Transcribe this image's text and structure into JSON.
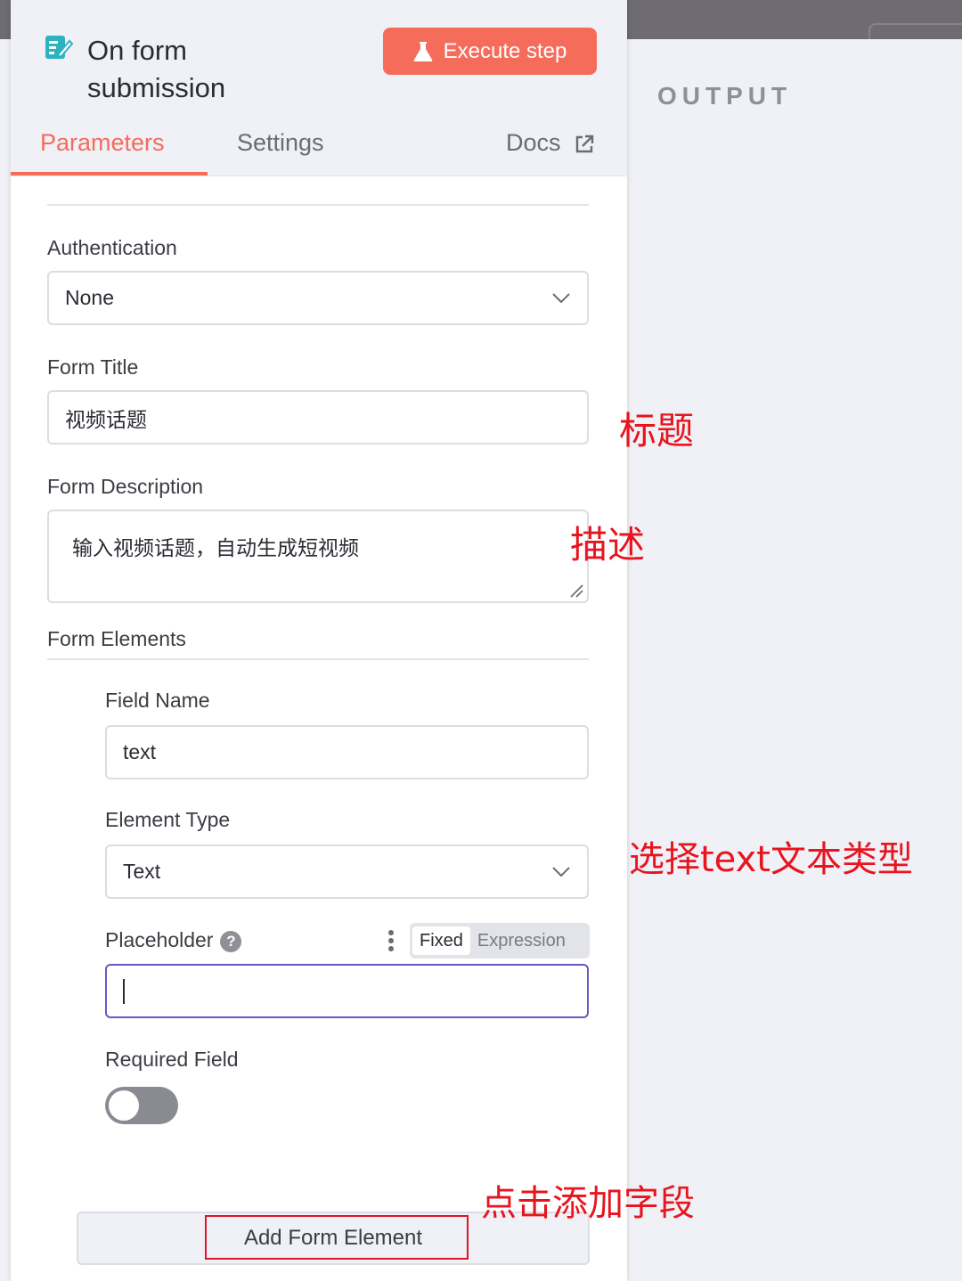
{
  "node": {
    "title_line1": "On form",
    "title_line2": "submission",
    "icon": "form-edit-icon",
    "execute_label": "Execute step",
    "execute_icon": "flask-icon"
  },
  "tabs": {
    "parameters": "Parameters",
    "settings": "Settings",
    "docs": "Docs"
  },
  "output_label": "OUTPUT",
  "form": {
    "authentication_label": "Authentication",
    "authentication_value": "None",
    "title_label": "Form Title",
    "title_value": "视频话题",
    "description_label": "Form Description",
    "description_value": "输入视频话题，自动生成短视频",
    "elements_label": "Form Elements",
    "field_name_label": "Field Name",
    "field_name_value": "text",
    "element_type_label": "Element Type",
    "element_type_value": "Text",
    "placeholder_label": "Placeholder",
    "placeholder_mode_fixed": "Fixed",
    "placeholder_mode_expression": "Expression",
    "placeholder_value": "",
    "required_label": "Required Field",
    "required_on": false,
    "add_button": "Add Form Element"
  },
  "annotations": {
    "title": "标题",
    "description": "描述",
    "type": "选择text文本类型",
    "add": "点击添加字段"
  },
  "colors": {
    "accent": "#f56c5b",
    "annotation": "#e8141e",
    "focus": "#6e55c8"
  }
}
